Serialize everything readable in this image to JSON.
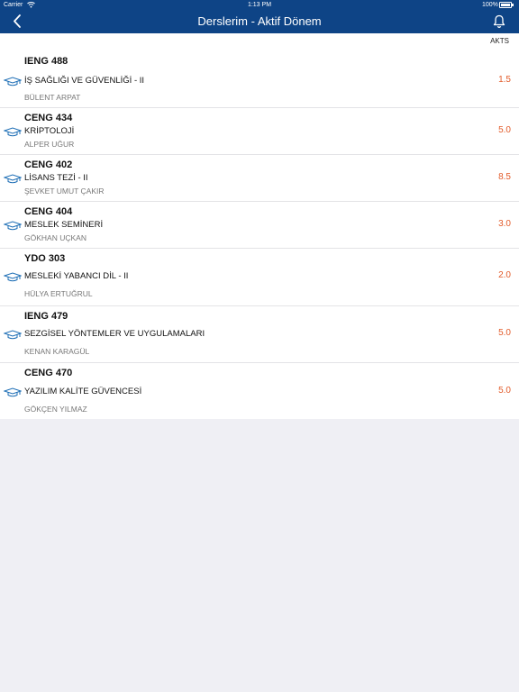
{
  "status_bar": {
    "carrier": "Carrier",
    "time": "1:13 PM",
    "battery": "100%"
  },
  "nav": {
    "title": "Derslerim - Aktif Dönem"
  },
  "list": {
    "column_header": "AKTS",
    "courses": [
      {
        "code": "IENG 488",
        "name": "İŞ SAĞLIĞI VE GÜVENLİĞİ - II",
        "teacher": "BÜLENT ARPAT",
        "credit": "1.5"
      },
      {
        "code": "CENG 434",
        "name": "KRİPTOLOJİ",
        "teacher": "ALPER UĞUR",
        "credit": "5.0"
      },
      {
        "code": "CENG 402",
        "name": "LİSANS TEZİ - II",
        "teacher": "ŞEVKET UMUT ÇAKIR",
        "credit": "8.5"
      },
      {
        "code": "CENG 404",
        "name": "MESLEK SEMİNERİ",
        "teacher": "GÖKHAN UÇKAN",
        "credit": "3.0"
      },
      {
        "code": "YDO 303",
        "name": "MESLEKİ YABANCI DİL - II",
        "teacher": "HÜLYA ERTUĞRUL",
        "credit": "2.0"
      },
      {
        "code": "IENG 479",
        "name": "SEZGİSEL YÖNTEMLER VE UYGULAMALARI",
        "teacher": "KENAN KARAGÜL",
        "credit": "5.0"
      },
      {
        "code": "CENG 470",
        "name": "YAZILIM KALİTE GÜVENCESİ",
        "teacher": "GÖKÇEN YILMAZ",
        "credit": "5.0"
      }
    ]
  },
  "colors": {
    "nav_bg": "#0e4486",
    "credit": "#e25b2a",
    "icon": "#1f6fb6",
    "background": "#efeff4"
  },
  "icons": {
    "back": "chevron-left-icon",
    "bell": "bell-icon",
    "course": "graduation-cap-icon",
    "wifi": "wifi-icon"
  }
}
